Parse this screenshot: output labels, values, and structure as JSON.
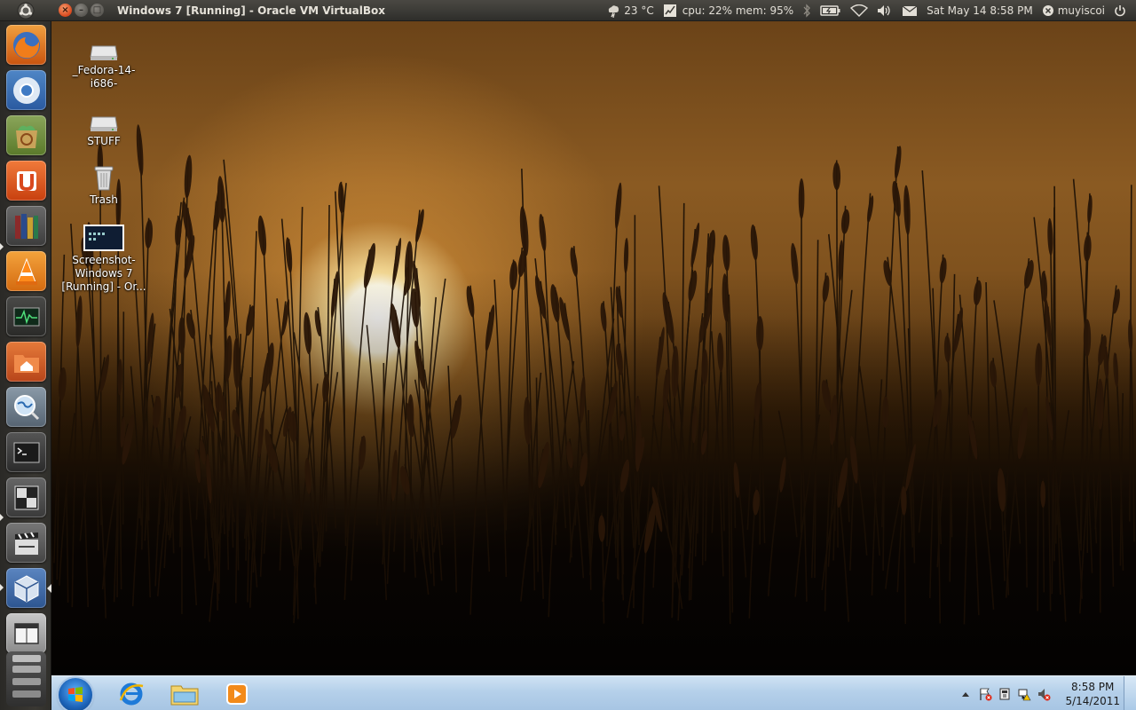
{
  "top_panel": {
    "window_title": "Windows 7 [Running] - Oracle VM VirtualBox",
    "weather": "23 °C",
    "system_monitor": "cpu: 22% mem: 95%",
    "datetime": "Sat May 14  8:58 PM",
    "username": "muyiscoi",
    "buttons": {
      "close": "×",
      "minimize": "–",
      "maximize": "□"
    }
  },
  "launcher": {
    "items": [
      {
        "name": "firefox",
        "icon": "firefox-icon"
      },
      {
        "name": "chromium",
        "icon": "chromium-icon"
      },
      {
        "name": "software-center",
        "icon": "software-center-icon"
      },
      {
        "name": "ubuntu-one",
        "icon": "ubuntu-one-icon"
      },
      {
        "name": "calibre",
        "icon": "bookshelf-icon"
      },
      {
        "name": "vlc",
        "icon": "vlc-cone-icon"
      },
      {
        "name": "system-monitor",
        "icon": "system-monitor-icon"
      },
      {
        "name": "home-folder",
        "icon": "home-folder-icon"
      },
      {
        "name": "web-browser",
        "icon": "globe-search-icon"
      },
      {
        "name": "terminal",
        "icon": "terminal-icon"
      },
      {
        "name": "workspace-switcher",
        "icon": "workspace-switcher-icon"
      },
      {
        "name": "video-editor",
        "icon": "clapperboard-icon"
      },
      {
        "name": "virtualbox",
        "icon": "virtualbox-icon"
      },
      {
        "name": "window-app",
        "icon": "window-icon"
      },
      {
        "name": "drives",
        "icon": "drive-stack-icon"
      }
    ]
  },
  "desktop": {
    "icons": [
      {
        "label_1": "_Fedora-14-",
        "label_2": "i686-",
        "icon": "drive-icon"
      },
      {
        "label_1": "STUFF",
        "icon": "drive-icon"
      },
      {
        "label_1": "Trash",
        "icon": "trash-icon"
      },
      {
        "label_1": "Screenshot-",
        "label_2": "Windows 7",
        "label_3": "[Running] - Or...",
        "icon": "screenshot-thumbnail-icon"
      }
    ]
  },
  "taskbar": {
    "pinned": [
      "internet-explorer-icon",
      "windows-explorer-icon",
      "media-player-icon"
    ],
    "clock_time": "8:58 PM",
    "clock_date": "5/14/2011",
    "colors": {
      "start_orb": "#1c63b8",
      "bar": "#b5d0ea"
    }
  },
  "colors": {
    "panel": "#3a3935",
    "close_button": "#d9481d",
    "launcher": "#3a3833"
  }
}
